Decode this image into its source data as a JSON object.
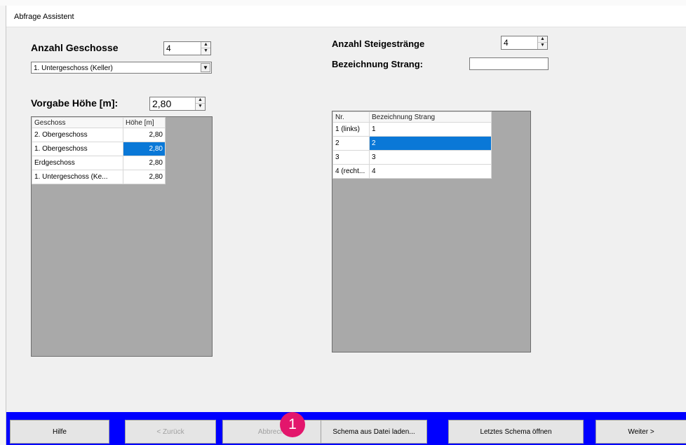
{
  "window": {
    "title": "Abfrage Assistent"
  },
  "left": {
    "floors_label": "Anzahl Geschosse",
    "floors_value": "4",
    "floor_select_value": "1. Untergeschoss (Keller)",
    "height_label": "Vorgabe Höhe [m]:",
    "height_value": "2,80",
    "grid": {
      "headers": [
        "Geschoss",
        "Höhe [m]"
      ],
      "rows": [
        {
          "name": "2. Obergeschoss",
          "height": "2,80"
        },
        {
          "name": "1. Obergeschoss",
          "height": "2,80"
        },
        {
          "name": "Erdgeschoss",
          "height": "2,80"
        },
        {
          "name": "1. Untergeschoss (Ke...",
          "height": "2,80"
        }
      ]
    }
  },
  "right": {
    "risers_label": "Anzahl Steigestränge",
    "risers_value": "4",
    "strand_label": "Bezeichnung Strang:",
    "strand_value": "",
    "grid": {
      "headers": [
        "Nr.",
        "Bezeichnung Strang"
      ],
      "rows": [
        {
          "nr": "1 (links)",
          "name": "1"
        },
        {
          "nr": "2",
          "name": "2"
        },
        {
          "nr": "3",
          "name": "3"
        },
        {
          "nr": "4 (recht...",
          "name": "4"
        }
      ]
    }
  },
  "buttons": {
    "help": "Hilfe",
    "back": "< Zurück",
    "cancel": "Abbrechen",
    "load_schema": "Schema aus Datei laden...",
    "open_last": "Letztes Schema öffnen",
    "next": "Weiter >"
  },
  "marker": {
    "label": "1",
    "color": "#e3166c"
  },
  "colors": {
    "selection": "#0a78d7",
    "bottom_bar": "#0000ff",
    "grid_background": "#a9a9a9"
  }
}
